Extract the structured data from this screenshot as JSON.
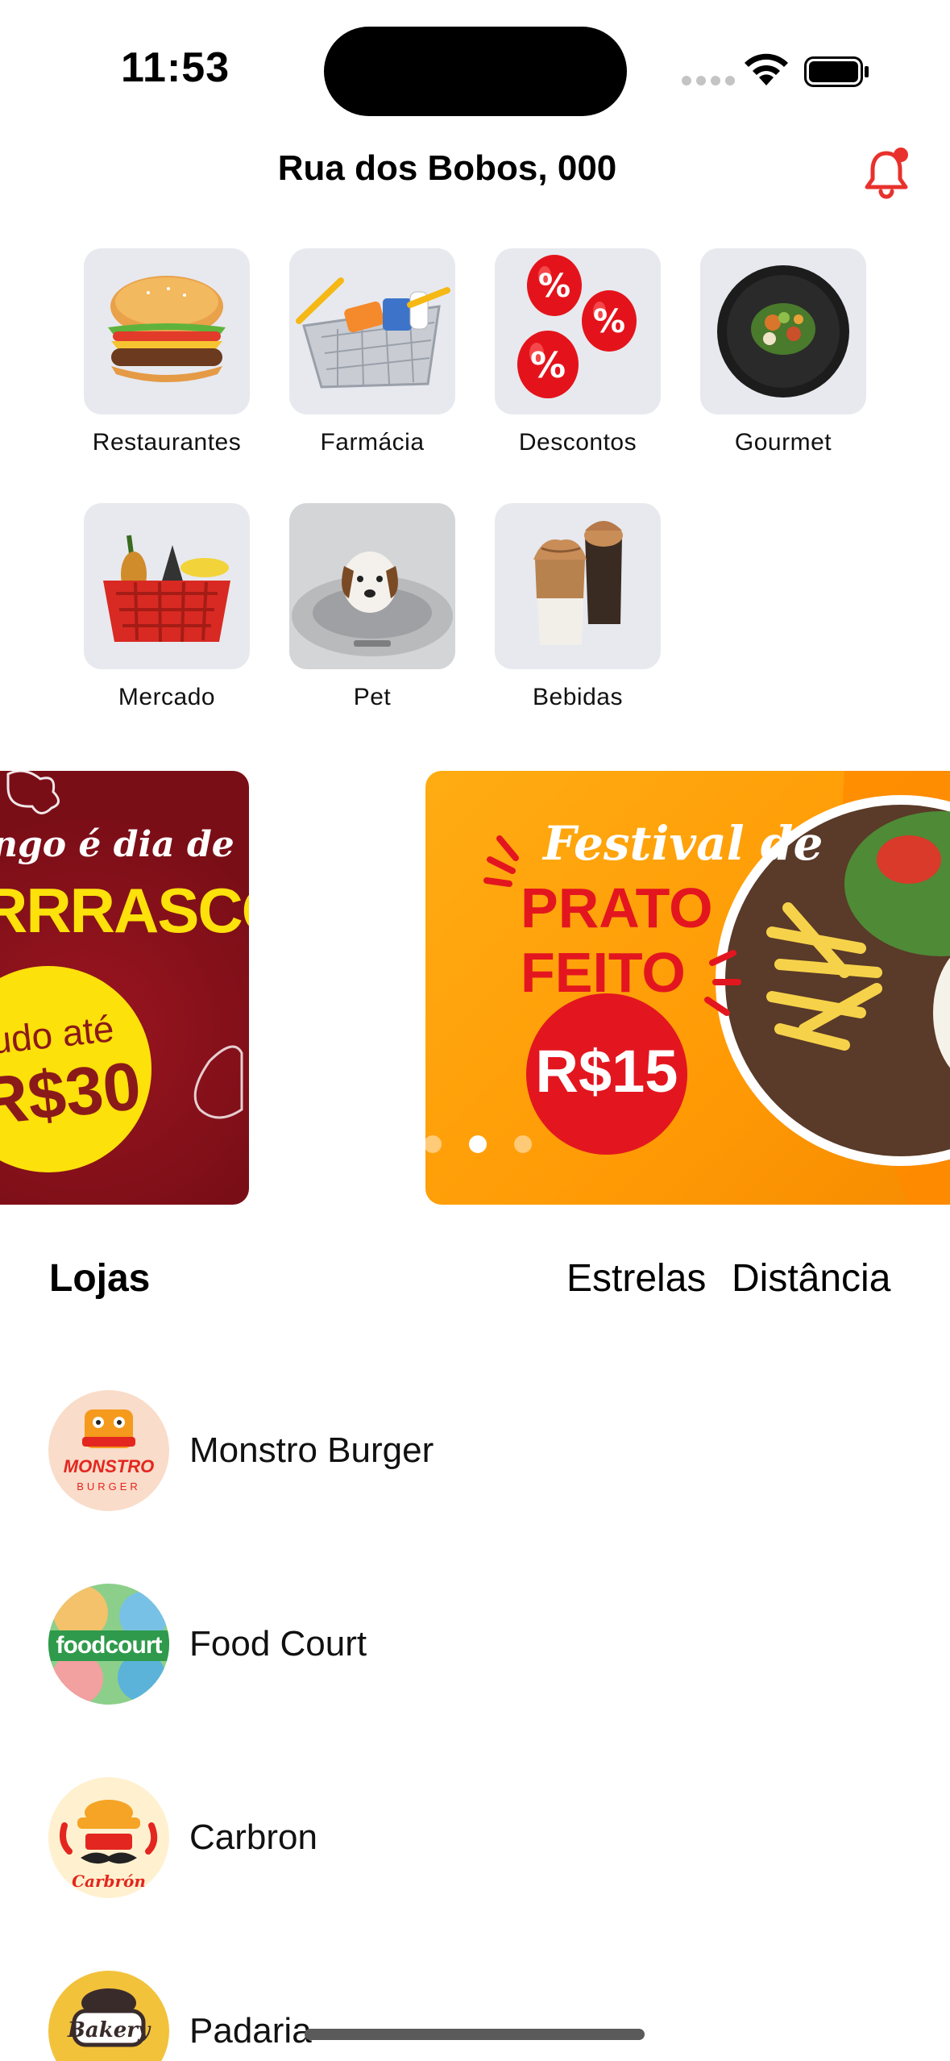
{
  "status_bar": {
    "time": "11:53"
  },
  "header": {
    "address": "Rua dos Bobos, 000",
    "has_notification": true
  },
  "categories": [
    {
      "label": "Restaurantes",
      "icon": "burger-icon"
    },
    {
      "label": "Farmácia",
      "icon": "pharmacy-basket-icon"
    },
    {
      "label": "Descontos",
      "icon": "percent-balloons-icon"
    },
    {
      "label": "Gourmet",
      "icon": "gourmet-plate-icon"
    },
    {
      "label": "Mercado",
      "icon": "grocery-basket-icon"
    },
    {
      "label": "Pet",
      "icon": "dog-bed-icon"
    },
    {
      "label": "Bebidas",
      "icon": "coffee-drinks-icon"
    }
  ],
  "banners": {
    "left": {
      "line1": "ngo é dia de",
      "line2": "RRRASCO",
      "badge_top": "udo até",
      "badge_price": "R$30"
    },
    "right": {
      "script": "Festival de",
      "line1": "PRATO",
      "line2": "FEITO",
      "price": "R$15"
    },
    "dots": 3,
    "active_dot": 1
  },
  "stores_section": {
    "title": "Lojas",
    "sort_stars": "Estrelas",
    "sort_distance": "Distância",
    "stores": [
      {
        "name": "Monstro Burger",
        "logo_text": "MONSTRO",
        "logo_sub": "BURGER",
        "logo_bg": "#f9dcc9"
      },
      {
        "name": "Food Court",
        "logo_text": "foodcourt",
        "logo_bg": "#8ccf8a"
      },
      {
        "name": "Carbron",
        "logo_text": "Carbrón",
        "logo_bg": "#fff1cf"
      },
      {
        "name": "Padaria",
        "logo_text": "Bakery",
        "logo_bg": "#f2c23b"
      }
    ]
  },
  "colors": {
    "accent_red": "#e8312c",
    "tile_bg": "#e7e9ee"
  }
}
